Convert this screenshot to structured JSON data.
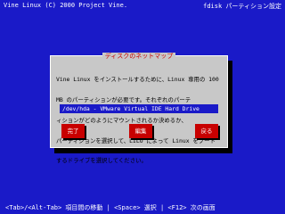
{
  "header": {
    "left": "Vine Linux (C) 2000 Project Vine.",
    "right": "fdisk パーティション設定"
  },
  "dialog": {
    "title": "ディスクのネットマップ",
    "body_lines": [
      "Vine Linux をインストールするために、Linux 専用の 100",
      "MB のパーティションが必要です。それぞれのパーテ",
      "ィションがどのようにマウントされるか決めるか、",
      "パーティションを選択して、LILO によって Linux をブート",
      "するドライブを選択してください。"
    ],
    "list": {
      "selected_item": "/dev/hda - VMware Virtual IDE Hard Drive"
    },
    "buttons": {
      "ok": "完了",
      "edit": "編集",
      "back": "戻る"
    }
  },
  "footer": {
    "hint": "<Tab>/<Alt-Tab> 項目間の移動  | <Space> 選択  | <F12> 次の画面"
  },
  "colors": {
    "background": "#1a1ac8",
    "dialog": "#c8c8c8",
    "button": "#c80000",
    "title_text": "#c80000"
  }
}
